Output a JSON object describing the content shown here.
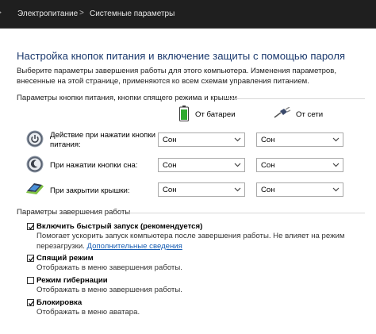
{
  "breadcrumb": {
    "items": [
      "Электропитание",
      "Системные параметры"
    ],
    "separator": ">"
  },
  "page": {
    "title": "Настройка кнопок питания и включение защиты с помощью пароля",
    "description": "Выберите параметры завершения работы для этого компьютера. Изменения параметров, внесенные на этой странице, применяются ко всем схемам управления питанием."
  },
  "buttons_section": {
    "title": "Параметры кнопки питания, кнопки спящего режима и крышки",
    "columns": [
      {
        "label": "От батареи",
        "icon": "battery-icon"
      },
      {
        "label": "От сети",
        "icon": "power-plug-icon"
      }
    ],
    "rows": [
      {
        "label": "Действие при нажатии кнопки питания:",
        "icon": "power-button-icon",
        "battery_value": "Сон",
        "ac_value": "Сон"
      },
      {
        "label": "При нажатии кнопки сна:",
        "icon": "sleep-button-icon",
        "battery_value": "Сон",
        "ac_value": "Сон"
      },
      {
        "label": "При закрытии крышки:",
        "icon": "laptop-lid-icon",
        "battery_value": "Сон",
        "ac_value": "Сон"
      }
    ]
  },
  "shutdown_section": {
    "title": "Параметры завершения работы",
    "options": [
      {
        "label": "Включить быстрый запуск (рекомендуется)",
        "checked": true,
        "desc": "Помогает ускорить запуск компьютера после завершения работы. Не влияет на режим перезагрузки.",
        "link": "Дополнительные сведения"
      },
      {
        "label": "Спящий режим",
        "checked": true,
        "desc": "Отображать в меню завершения работы."
      },
      {
        "label": "Режим гибернации",
        "checked": false,
        "desc": "Отображать в меню завершения работы."
      },
      {
        "label": "Блокировка",
        "checked": true,
        "desc": "Отображать в меню аватара."
      }
    ]
  },
  "colors": {
    "title": "#1c3a6e",
    "link": "#1a5fb4",
    "addressbar_bg": "#1f1f1f"
  }
}
